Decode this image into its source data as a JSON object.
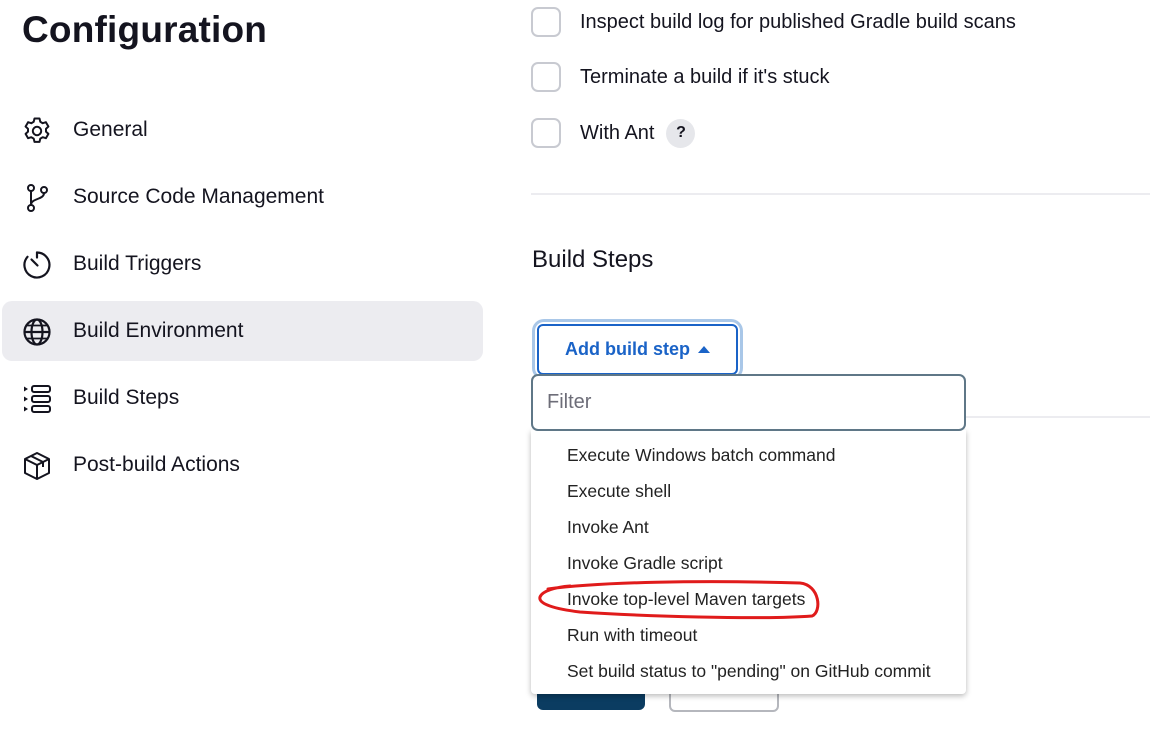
{
  "page_title": "Configuration",
  "sidebar": {
    "items": [
      {
        "label": "General",
        "icon": "gear-icon",
        "active": false
      },
      {
        "label": "Source Code Management",
        "icon": "git-branch-icon",
        "active": false
      },
      {
        "label": "Build Triggers",
        "icon": "timer-icon",
        "active": false
      },
      {
        "label": "Build Environment",
        "icon": "globe-icon",
        "active": true
      },
      {
        "label": "Build Steps",
        "icon": "list-icon",
        "active": false
      },
      {
        "label": "Post-build Actions",
        "icon": "package-icon",
        "active": false
      }
    ]
  },
  "build_environment": {
    "options": [
      {
        "label": "Inspect build log for published Gradle build scans",
        "checked": false
      },
      {
        "label": "Terminate a build if it's stuck",
        "checked": false
      },
      {
        "label": "With Ant",
        "checked": false,
        "help": "?"
      }
    ]
  },
  "build_steps": {
    "heading": "Build Steps",
    "add_button_label": "Add build step",
    "filter_placeholder": "Filter",
    "menu_items": [
      "Execute Windows batch command",
      "Execute shell",
      "Invoke Ant",
      "Invoke Gradle script",
      "Invoke top-level Maven targets",
      "Run with timeout",
      "Set build status to \"pending\" on GitHub commit"
    ],
    "highlighted_item": "Invoke top-level Maven targets"
  },
  "colors": {
    "accent": "#1a63c7",
    "active_nav_bg": "#ececf0",
    "annotation": "#e01b1b",
    "save_button": "#0b3c61"
  }
}
